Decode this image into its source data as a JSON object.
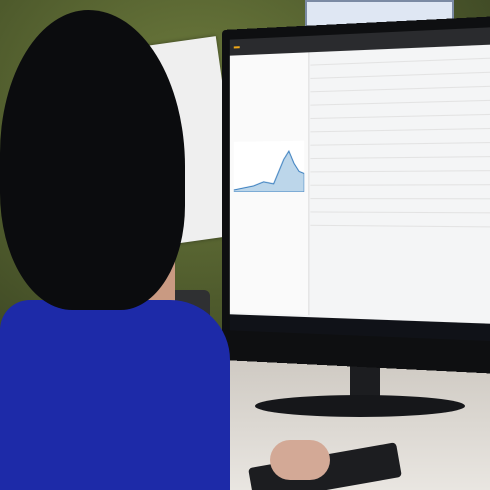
{
  "sign_text": "",
  "screen": {
    "logo": "",
    "nav": [
      "",
      "",
      "",
      ""
    ],
    "rows": [
      "",
      "",
      "",
      "",
      "",
      "",
      "",
      "",
      "",
      "",
      "",
      "",
      ""
    ]
  }
}
